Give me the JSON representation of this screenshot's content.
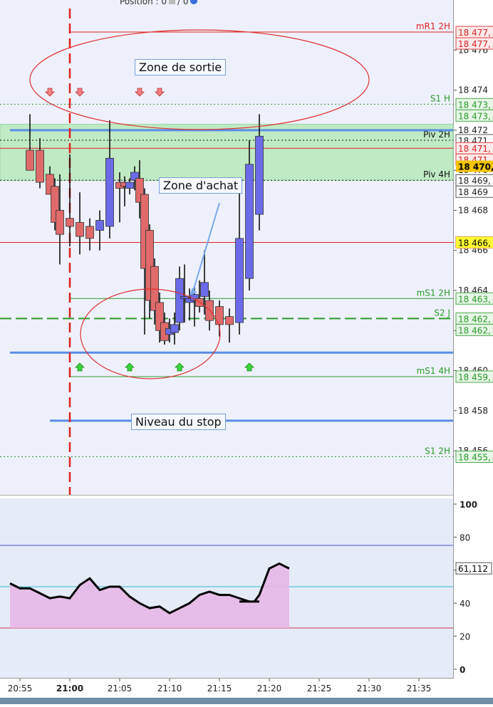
{
  "header": {
    "position_text": "Position : 0",
    "position_tail": "/ 0"
  },
  "annotations": {
    "exit_zone": "Zone de sortie",
    "buy_zone": "Zone d'achat",
    "stop_level": "Niveau du stop"
  },
  "colors": {
    "bull": "#6b6be8",
    "bear": "#e06a6a",
    "resistance": "#dd2222",
    "support": "#2a9a2a",
    "pivot": "#111111",
    "blue_line": "#5b8de8",
    "zone_fill": "#bfeac4",
    "rsi_fill": "#e6b8e6",
    "highlight": "#f5c400"
  },
  "chart_data": [
    {
      "type": "candlestick",
      "ylim": [
        18453.8,
        18478.5
      ],
      "y_ticks": [
        18476,
        18474,
        18472,
        18470,
        18468,
        18466,
        18464,
        18462,
        18460,
        18458,
        18456
      ],
      "y_tick_labels": [
        "18 476",
        "18 474",
        "18 472",
        "18 470",
        "18 468",
        "18 466",
        "18 464",
        "18 462",
        "18 460",
        "18 458",
        "18 456"
      ],
      "x_labels": [
        "20:55",
        "21:00",
        "21:05",
        "21:10",
        "21:15",
        "21:20",
        "21:25",
        "21:30",
        "21:35"
      ],
      "x_label_minutes": [
        -5,
        0,
        5,
        10,
        15,
        20,
        25,
        30,
        35
      ],
      "x_bold_label": "21:00",
      "vertical_marker_minute": 0,
      "candles": [
        {
          "t": -4,
          "o": 18471.0,
          "h": 18472.8,
          "l": 18470.0,
          "c": 18470.0
        },
        {
          "t": -3,
          "o": 18471.0,
          "h": 18471.6,
          "l": 18469.1,
          "c": 18469.4
        },
        {
          "t": -2,
          "o": 18469.8,
          "h": 18470.2,
          "l": 18468.8,
          "c": 18468.8
        },
        {
          "t": -1.5,
          "o": 18469.2,
          "h": 18469.6,
          "l": 18467.0,
          "c": 18467.4
        },
        {
          "t": -1,
          "o": 18468.0,
          "h": 18469.8,
          "l": 18465.3,
          "c": 18466.8
        },
        {
          "t": 0,
          "o": 18467.6,
          "h": 18470.8,
          "l": 18466.2,
          "c": 18467.2
        },
        {
          "t": 1,
          "o": 18467.4,
          "h": 18468.9,
          "l": 18465.8,
          "c": 18466.7
        },
        {
          "t": 2,
          "o": 18467.2,
          "h": 18467.6,
          "l": 18466.0,
          "c": 18466.6
        },
        {
          "t": 3,
          "o": 18467.0,
          "h": 18468.0,
          "l": 18466.0,
          "c": 18467.5
        },
        {
          "t": 4,
          "o": 18467.2,
          "h": 18472.5,
          "l": 18466.6,
          "c": 18470.6
        },
        {
          "t": 5,
          "o": 18469.4,
          "h": 18469.9,
          "l": 18467.4,
          "c": 18469.1
        },
        {
          "t": 5.5,
          "o": 18469.4,
          "h": 18469.7,
          "l": 18468.2,
          "c": 18469.2
        },
        {
          "t": 6,
          "o": 18469.1,
          "h": 18469.6,
          "l": 18468.8,
          "c": 18469.4
        },
        {
          "t": 6.5,
          "o": 18469.5,
          "h": 18470.2,
          "l": 18469.0,
          "c": 18469.9
        },
        {
          "t": 7,
          "o": 18469.6,
          "h": 18470.5,
          "l": 18467.6,
          "c": 18468.4
        },
        {
          "t": 7.5,
          "o": 18468.8,
          "h": 18469.1,
          "l": 18461.8,
          "c": 18465.1
        },
        {
          "t": 8,
          "o": 18467.0,
          "h": 18467.3,
          "l": 18462.6,
          "c": 18463.5
        },
        {
          "t": 8.5,
          "o": 18465.2,
          "h": 18465.6,
          "l": 18462.3,
          "c": 18463.0
        },
        {
          "t": 9,
          "o": 18463.4,
          "h": 18463.9,
          "l": 18461.4,
          "c": 18462.0
        },
        {
          "t": 9.5,
          "o": 18462.4,
          "h": 18462.9,
          "l": 18461.3,
          "c": 18461.5
        },
        {
          "t": 10,
          "o": 18461.8,
          "h": 18462.6,
          "l": 18461.4,
          "c": 18462.1
        },
        {
          "t": 10.5,
          "o": 18461.9,
          "h": 18462.9,
          "l": 18461.3,
          "c": 18462.3
        },
        {
          "t": 11,
          "o": 18462.4,
          "h": 18465.2,
          "l": 18462.0,
          "c": 18464.6
        },
        {
          "t": 11.5,
          "o": 18463.6,
          "h": 18465.3,
          "l": 18462.4,
          "c": 18463.7
        },
        {
          "t": 12,
          "o": 18463.4,
          "h": 18464.1,
          "l": 18462.5,
          "c": 18463.6
        },
        {
          "t": 12.5,
          "o": 18463.5,
          "h": 18464.2,
          "l": 18462.2,
          "c": 18463.8
        },
        {
          "t": 13,
          "o": 18463.6,
          "h": 18464.5,
          "l": 18462.9,
          "c": 18463.2
        },
        {
          "t": 13.5,
          "o": 18463.7,
          "h": 18466.0,
          "l": 18462.8,
          "c": 18464.4
        },
        {
          "t": 14,
          "o": 18463.5,
          "h": 18464.0,
          "l": 18462.0,
          "c": 18462.5
        },
        {
          "t": 15,
          "o": 18463.2,
          "h": 18463.5,
          "l": 18461.7,
          "c": 18462.3
        },
        {
          "t": 16,
          "o": 18462.7,
          "h": 18463.1,
          "l": 18461.4,
          "c": 18462.3
        },
        {
          "t": 17,
          "o": 18462.4,
          "h": 18469.2,
          "l": 18461.8,
          "c": 18466.6
        },
        {
          "t": 18,
          "o": 18464.6,
          "h": 18471.5,
          "l": 18464.0,
          "c": 18470.3
        },
        {
          "t": 19,
          "o": 18467.8,
          "h": 18472.8,
          "l": 18467.0,
          "c": 18471.7
        }
      ],
      "candle_slots": 35,
      "zone": {
        "low": 18469.5,
        "high": 18472.3
      },
      "levels": [
        {
          "name": "mR1 2H",
          "value": 18476.9,
          "style": "solid",
          "color": "resistance",
          "tag": "18 477,",
          "tag2": "18 477,"
        },
        {
          "name": "S1 H",
          "value": 18473.3,
          "style": "dotted",
          "color": "support",
          "tag": "18 473,",
          "tag2": "18 473,"
        },
        {
          "name": "Piv 2H",
          "value": 18471.5,
          "style": "dotted",
          "color": "pivot",
          "tag": "18 471,"
        },
        {
          "name": "",
          "value": 18471.1,
          "style": "solid",
          "color": "resistance",
          "tag": "18 471,",
          "tag2": "18 471,"
        },
        {
          "name": "Piv 4H",
          "value": 18469.5,
          "style": "dotted",
          "color": "pivot",
          "tag": "18 469,",
          "tag2": "18 469"
        },
        {
          "name": "",
          "value": 18466.4,
          "style": "solid",
          "color": "resistance",
          "tag": "18 466,"
        },
        {
          "name": "mS1 2H",
          "value": 18463.6,
          "style": "solid",
          "color": "support",
          "tag": "18 463,"
        },
        {
          "name": "S2 J",
          "value": 18462.6,
          "style": "dashed",
          "color": "support",
          "tag": "18 462,",
          "tag2": "18 462,"
        },
        {
          "name": "mS1 4H",
          "value": 18459.7,
          "style": "solid",
          "color": "support",
          "tag": "18 459,"
        },
        {
          "name": "S1 2H",
          "value": 18455.7,
          "style": "dotted",
          "color": "support",
          "tag": "18 455,"
        }
      ],
      "current_price_tag": "18 470,",
      "highlight_tag": "18 466,",
      "blue_lines": [
        {
          "value": 18472.0,
          "from_minute": -6,
          "to_minute": 43
        },
        {
          "value": 18460.9,
          "from_minute": -6,
          "to_minute": 43
        },
        {
          "value": 18457.5,
          "from_minute": -2,
          "to_minute": 43
        }
      ],
      "sell_arrows_minutes": [
        -2,
        1,
        7,
        9
      ],
      "buy_arrows_minutes": [
        1,
        6,
        11,
        18
      ]
    },
    {
      "type": "area",
      "ylim": [
        -2,
        103
      ],
      "y_ticks": [
        100,
        80,
        60,
        40,
        20,
        0
      ],
      "levels": [
        75,
        50,
        25
      ],
      "x": [
        -6,
        -5,
        -4,
        -3,
        -2,
        -1,
        0,
        1,
        2,
        3,
        4,
        5,
        6,
        7,
        8,
        9,
        10,
        11,
        12,
        13,
        14,
        15,
        16,
        17,
        18,
        19
      ],
      "values": [
        52,
        49,
        49,
        46,
        43,
        44,
        43,
        51,
        55,
        48,
        50,
        50,
        44,
        40,
        37,
        38,
        34,
        37,
        40,
        45,
        47,
        45,
        45,
        43,
        41,
        41
      ],
      "extra": [
        [
          17,
          41
        ],
        [
          18,
          41
        ],
        [
          18.5,
          41
        ],
        [
          19,
          45
        ],
        [
          20,
          61
        ],
        [
          21,
          64
        ],
        [
          22,
          61
        ]
      ],
      "last_value": "61,112"
    }
  ]
}
